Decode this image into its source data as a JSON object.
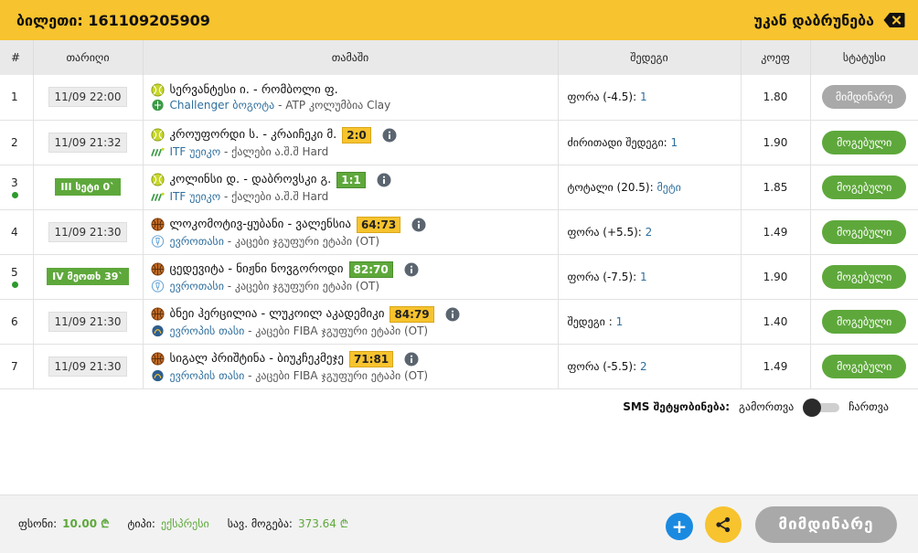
{
  "header": {
    "ticket_label": "ბილეთი: 161109205909",
    "back_label": "უკან დაბრუნება"
  },
  "table": {
    "headers": {
      "num": "#",
      "date": "თარიღი",
      "game": "თამაში",
      "result": "შედეგი",
      "coef": "კოეფ",
      "status": "სტატუსი"
    },
    "rows": [
      {
        "num": "1",
        "date": "11/09 22:00",
        "teams": "სერვანტესი ი. - რომბოლი ფ.",
        "tournament_name": "Challenger ბოგოტა",
        "tournament_rest": " - ATP კოლუმბია Clay",
        "result_label": "ფორა (-4.5): ",
        "result_value": "1",
        "coef": "1.80",
        "status": "მიმდინარე"
      },
      {
        "num": "2",
        "date": "11/09 21:32",
        "teams": "კროუფორდი ს. - კრაიჩეკი მ.",
        "score": "2:0",
        "tournament_name": "ITF უეიკო",
        "tournament_rest": " - ქალები ა.შ.შ Hard",
        "result_label": "ძირითადი შედეგი: ",
        "result_value": "1",
        "coef": "1.90",
        "status": "მოგებული"
      },
      {
        "num": "3",
        "live": "III სეტი 0`",
        "teams": "კოლინსი დ. - დაბროვსკი გ.",
        "score": "1:1",
        "tournament_name": "ITF უეიკო",
        "tournament_rest": " - ქალები ა.შ.შ Hard",
        "result_label": "ტოტალი (20.5): ",
        "result_value": "მეტი",
        "coef": "1.85",
        "status": "მოგებული"
      },
      {
        "num": "4",
        "date": "11/09 21:30",
        "teams": "ლოკომოტივ-ყუბანი - ვალენსია",
        "score": "64:73",
        "tournament_name": "ევროთასი",
        "tournament_rest": " - კაცები ჯგუფური ეტაპი (OT)",
        "result_label": "ფორა (+5.5): ",
        "result_value": "2",
        "coef": "1.49",
        "status": "მოგებული"
      },
      {
        "num": "5",
        "live": "IV მეოთხ 39`",
        "teams": "ცედევიტა - ნიჟნი ნოვგოროდი",
        "score": "82:70",
        "tournament_name": "ევროთასი",
        "tournament_rest": " - კაცები ჯგუფური ეტაპი (OT)",
        "result_label": "ფორა (-7.5): ",
        "result_value": "1",
        "coef": "1.90",
        "status": "მოგებული"
      },
      {
        "num": "6",
        "date": "11/09 21:30",
        "teams": "ბნეი ჰერცილია - ლუკოილ აკადემიკი",
        "score": "84:79",
        "tournament_name": "ევროპის თასი",
        "tournament_rest": " - კაცები FIBA ჯგუფური ეტაპი (OT)",
        "result_label": "შედეგი : ",
        "result_value": "1",
        "coef": "1.40",
        "status": "მოგებული"
      },
      {
        "num": "7",
        "date": "11/09 21:30",
        "teams": "სიგალ პრიშტინა - ბიუკჩეკმეჯე",
        "score": "71:81",
        "tournament_name": "ევროპის თასი",
        "tournament_rest": " - კაცები FIBA ჯგუფური ეტაპი (OT)",
        "result_label": "ფორა (-5.5): ",
        "result_value": "2",
        "coef": "1.49",
        "status": "მოგებული"
      }
    ]
  },
  "sms": {
    "label": "SMS შეტყობინება:",
    "off": "გამორთვა",
    "on": "ჩართვა"
  },
  "footer": {
    "stake_label": "ფსონი:",
    "stake_value": "10.00 ₾",
    "type_label": "ტიპი:",
    "type_value": "ექსპრესი",
    "win_label": "სავ. მოგება:",
    "win_value": "373.64 ₾",
    "plus": "+",
    "status_button": "მიმდინარე"
  },
  "colors": {
    "accent": "#f7c32e",
    "won": "#5ea83b",
    "pending": "#a9a9a9",
    "link": "#2f6f9e",
    "plus": "#1a8ae0"
  },
  "icons": {
    "tennis": "tennis-ball-icon",
    "basketball": "basketball-icon",
    "info": "info-icon",
    "share": "share-icon",
    "back": "backspace-icon"
  }
}
